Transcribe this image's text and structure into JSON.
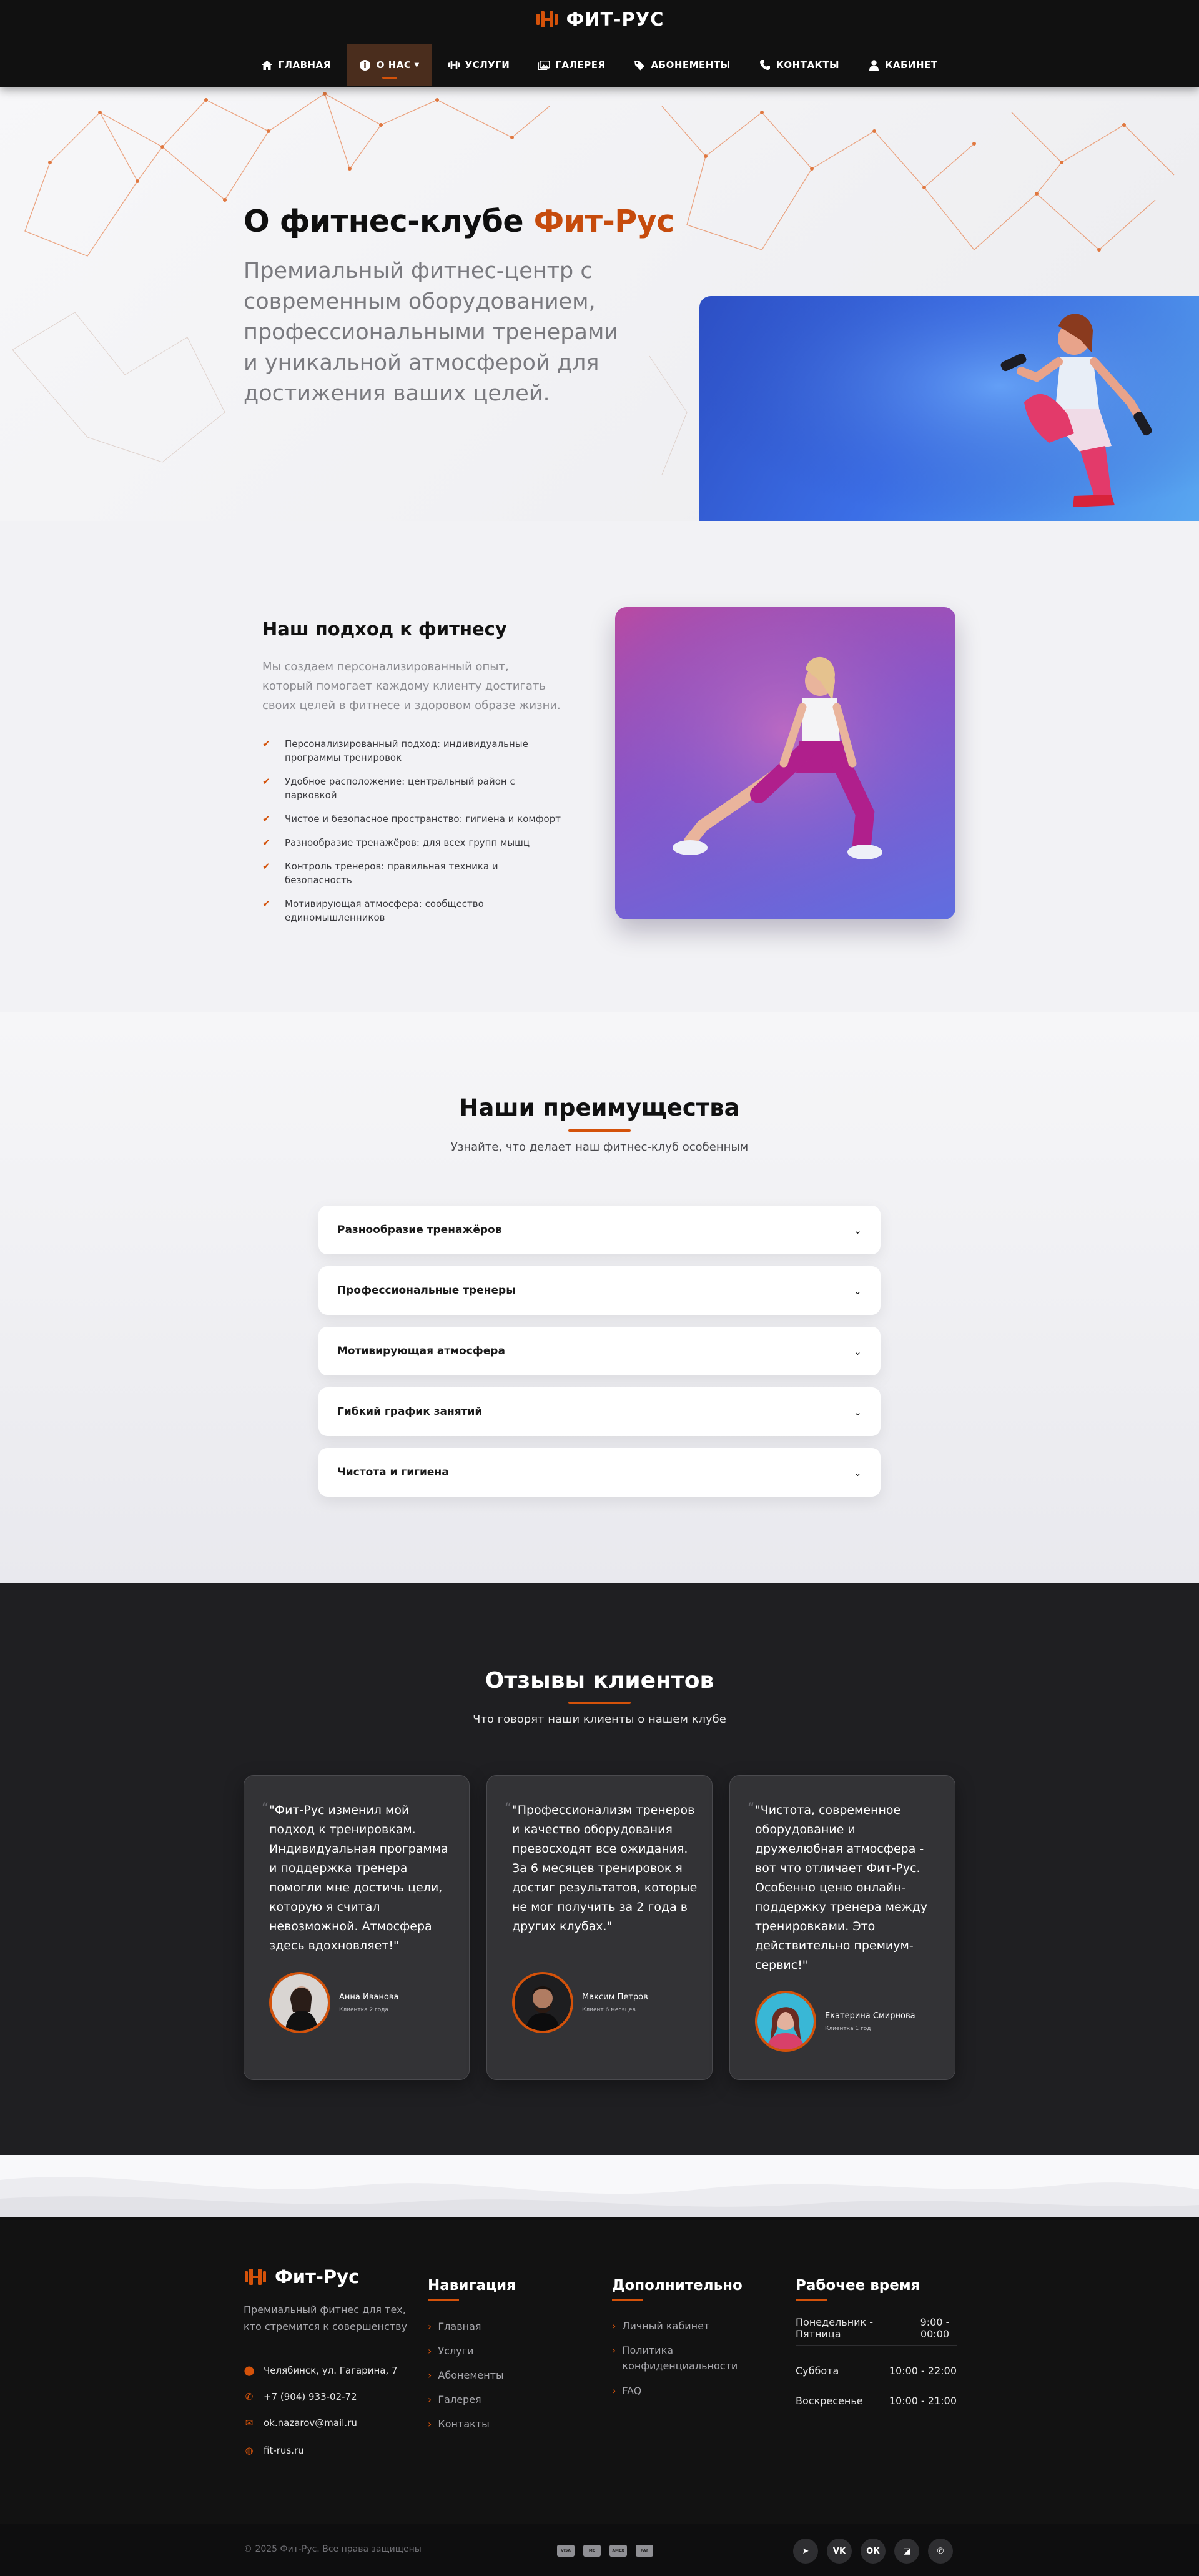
{
  "brand": {
    "name": "ФИТ-РУС",
    "accent_color": "#d4520a"
  },
  "nav": {
    "items": [
      {
        "label": "ГЛАВНАЯ",
        "icon": "home-icon"
      },
      {
        "label": "О НАС",
        "icon": "info-icon",
        "active": true
      },
      {
        "label": "УСЛУГИ",
        "icon": "dumbbell-icon"
      },
      {
        "label": "ГАЛЕРЕЯ",
        "icon": "gallery-icon"
      },
      {
        "label": "АБОНЕМЕНТЫ",
        "icon": "tag-icon"
      },
      {
        "label": "КОНТАКТЫ",
        "icon": "phone-icon"
      },
      {
        "label": "КАБИНЕТ",
        "icon": "user-icon"
      }
    ]
  },
  "hero": {
    "title": "О фитнес-клубе ",
    "title_accent": "Фит-Рус",
    "text": "Премиальный фитнес-центр с современным оборудованием, профессиональными тренерами и уникальной атмосферой для достижения ваших целей."
  },
  "approach": {
    "title": "Наш подход к фитнесу",
    "description": "Мы создаем персонализированный опыт, который помогает каждому клиенту достигать своих целей в фитнесе и здоровом образе жизни.",
    "items": [
      "Персонализированный подход: индивидуальные программы тренировок",
      "Удобное расположение: центральный район с парковкой",
      "Чистое и безопасное пространство: гигиена и комфорт",
      "Разнообразие тренажёров: для всех групп мышц",
      "Контроль тренеров: правильная техника и безопасность",
      "Мотивирующая атмосфера: сообщество единомышленников"
    ]
  },
  "advantages": {
    "title": "Наши преимущества",
    "subtitle": "Узнайте, что делает наш фитнес-клуб особенным",
    "items": [
      "Разнообразие тренажёров",
      "Профессиональные тренеры",
      "Мотивирующая атмосфера",
      "Гибкий график занятий",
      "Чистота и гигиена"
    ]
  },
  "reviews": {
    "title": "Отзывы клиентов",
    "subtitle": "Что говорят наши клиенты о нашем клубе",
    "items": [
      {
        "text": "\"Фит-Рус изменил мой подход к тренировкам. Индивидуальная программа и поддержка тренера помогли мне достичь цели, которую я считал невозможной. Атмосфера здесь вдохновляет!\"",
        "name": "Анна Иванова",
        "meta": "Клиентка 2 года"
      },
      {
        "text": "\"Профессионализм тренеров и качество оборудования превосходят все ожидания. За 6 месяцев тренировок я достиг результатов, которые не мог получить за 2 года в других клубах.\"",
        "name": "Максим Петров",
        "meta": "Клиент 6 месяцев"
      },
      {
        "text": "\"Чистота, современное оборудование и дружелюбная атмосфера - вот что отличает Фит-Рус. Особенно ценю онлайн-поддержку тренера между тренировками. Это действительно премиум-сервис!\"",
        "name": "Екатерина Смирнова",
        "meta": "Клиентка 1 год"
      }
    ]
  },
  "footer": {
    "brand": "Фит-Рус",
    "description": "Премиальный фитнес для тех, кто стремится к совершенству",
    "contacts": [
      {
        "icon": "location-icon",
        "text": "Челябинск, ул. Гагарина, 7"
      },
      {
        "icon": "phone-icon",
        "text": "+7 (904) 933-02-72"
      },
      {
        "icon": "mail-icon",
        "text": "ok.nazarov@mail.ru"
      },
      {
        "icon": "globe-icon",
        "text": "fit-rus.ru"
      }
    ],
    "nav_title": "Навигация",
    "nav_links": [
      "Главная",
      "Услуги",
      "Абонементы",
      "Галерея",
      "Контакты"
    ],
    "extra_title": "Дополнительно",
    "extra_links": [
      "Личный кабинет",
      "Политика конфиденциальности",
      "FAQ"
    ],
    "hours_title": "Рабочее время",
    "hours": [
      {
        "day": "Понедельник - Пятница",
        "time": "9:00 - 00:00"
      },
      {
        "day": "Суббота",
        "time": "10:00 - 22:00"
      },
      {
        "day": "Воскресенье",
        "time": "10:00 - 21:00"
      }
    ],
    "copyright": "© 2025 Фит-Рус. Все права защищены",
    "payments": [
      "VISA",
      "MC",
      "AMEX",
      "PAY"
    ],
    "socials": [
      {
        "icon": "telegram-icon",
        "glyph": "➤"
      },
      {
        "icon": "vk-icon",
        "glyph": "VK"
      },
      {
        "icon": "ok-icon",
        "glyph": "ОК"
      },
      {
        "icon": "twitch-icon",
        "glyph": "◪"
      },
      {
        "icon": "whatsapp-icon",
        "glyph": "✆"
      }
    ]
  }
}
